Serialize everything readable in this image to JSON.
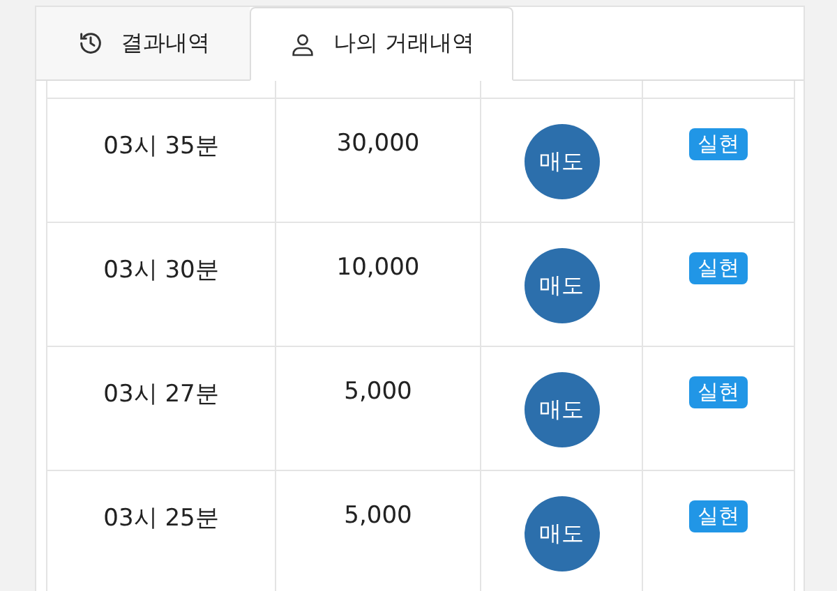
{
  "tabs": [
    {
      "label": "결과내역",
      "kind": "history",
      "selected": false
    },
    {
      "label": "나의 거래내역",
      "kind": "user",
      "selected": true
    }
  ],
  "rows": [
    {
      "time": "03시 35분",
      "amount": "30,000",
      "side": "매도",
      "status": "실현"
    },
    {
      "time": "03시 30분",
      "amount": "10,000",
      "side": "매도",
      "status": "실현"
    },
    {
      "time": "03시 27분",
      "amount": "5,000",
      "side": "매도",
      "status": "실현"
    },
    {
      "time": "03시 25분",
      "amount": "5,000",
      "side": "매도",
      "status": "실현"
    }
  ]
}
